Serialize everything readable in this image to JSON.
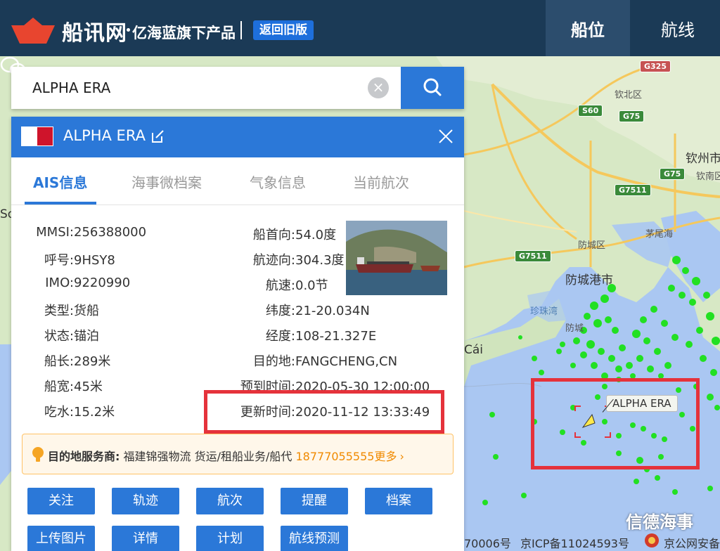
{
  "header": {
    "brand": "船讯网",
    "slogan": "亿海蓝旗下产品",
    "old_version": "返回旧版",
    "tabs": [
      "船位",
      "航线"
    ]
  },
  "search": {
    "value": "ALPHA ERA",
    "clear_icon": "close-circle-icon",
    "search_icon": "magnifier-icon"
  },
  "ship_panel": {
    "name": "ALPHA ERA",
    "flag": "Malta",
    "tabs": [
      "AIS信息",
      "海事微档案",
      "气象信息",
      "当前航次"
    ],
    "info_left": [
      {
        "k": "MMSI:",
        "v": "256388000"
      },
      {
        "k": "呼号:",
        "v": "9HSY8"
      },
      {
        "k": "IMO:",
        "v": "9220990"
      },
      {
        "k": "类型:",
        "v": "货船"
      },
      {
        "k": "状态:",
        "v": "锚泊"
      },
      {
        "k": "船长:",
        "v": "289米"
      },
      {
        "k": "船宽:",
        "v": "45米"
      },
      {
        "k": "吃水:",
        "v": "15.2米"
      }
    ],
    "info_right": [
      {
        "k": "船首向:",
        "v": "54.0度"
      },
      {
        "k": "航迹向:",
        "v": "304.3度"
      },
      {
        "k": "航速:",
        "v": "0.0节"
      },
      {
        "k": "纬度:",
        "v": "21-20.034N"
      },
      {
        "k": "经度:",
        "v": "108-21.327E"
      },
      {
        "k": "目的地:",
        "v": "FANGCHENG,CN"
      },
      {
        "k": "预到时间:",
        "v": "2020-05-30 12:00:00"
      },
      {
        "k": "更新时间:",
        "v": "2020-11-12 13:33:49"
      }
    ],
    "service": {
      "label": "目的地服务商:",
      "company": "福建锦强物流 货运/租船业务/船代",
      "phone": "18777055555",
      "more": "更多"
    },
    "buttons_row1": [
      "关注",
      "轨迹",
      "航次",
      "提醒",
      "档案"
    ],
    "buttons_row2": [
      "上传图片",
      "详情",
      "计划",
      "航线预测"
    ]
  },
  "map": {
    "labels": [
      "钦北区",
      "钦州市",
      "钦南区",
      "茅尾海",
      "防城区",
      "防城港市",
      "珍珠湾",
      "防城",
      "Cái",
      "So"
    ],
    "roads": [
      "G325",
      "S60",
      "G75",
      "G75",
      "G7511",
      "G7511"
    ],
    "ship_label": "ALPHA ERA",
    "footer_left": "70006号",
    "footer_icp": "京ICP备11024593号",
    "footer_police": "京公网安备",
    "watermark": "信德海事"
  },
  "colors": {
    "header_bg": "#1b3a56",
    "accent": "#2b78d8",
    "sea": "#aac7f2",
    "ship_marker": "#22e022",
    "highlight": "#e5323b",
    "service_accent": "#f08a00"
  }
}
